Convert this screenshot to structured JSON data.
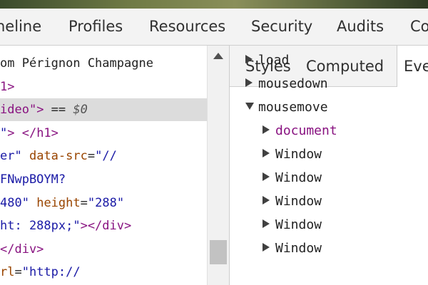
{
  "tabs": [
    "neline",
    "Profiles",
    "Resources",
    "Security",
    "Audits",
    "Co"
  ],
  "elements_lines": [
    {
      "parts": [
        [
          "txt",
          "om Pérignon Champagne"
        ]
      ]
    },
    {
      "parts": [
        [
          "tag",
          "1>"
        ]
      ]
    },
    {
      "parts": [
        [
          "tag",
          "ideo"
        ],
        [
          "tag",
          "\">"
        ],
        [
          "txt",
          " == "
        ],
        [
          "dollar",
          "$0"
        ]
      ]
    },
    {
      "parts": [
        [
          "val",
          "\""
        ],
        [
          "tag",
          "> </h1>"
        ]
      ]
    },
    {
      "parts": [
        [
          "val",
          "er\""
        ],
        [
          "txt",
          " "
        ],
        [
          "attr",
          "data-src"
        ],
        [
          "txt",
          "="
        ],
        [
          "val",
          "\"//"
        ]
      ]
    },
    {
      "parts": [
        [
          "val",
          "FNwpBOYM?"
        ]
      ]
    },
    {
      "parts": [
        [
          "val",
          "480\""
        ],
        [
          "txt",
          " "
        ],
        [
          "attr",
          "height"
        ],
        [
          "txt",
          "="
        ],
        [
          "val",
          "\"288\""
        ]
      ]
    },
    {
      "parts": [
        [
          "val",
          "ht: 288px;\""
        ],
        [
          "tag",
          "></div>"
        ]
      ]
    },
    {
      "parts": [
        [
          "tag",
          "</div>"
        ]
      ]
    },
    {
      "parts": [
        [
          "attr",
          "rl"
        ],
        [
          "txt",
          "="
        ],
        [
          "val",
          "\"http://"
        ]
      ]
    }
  ],
  "sidebar_tabs": [
    "Styles",
    "Computed",
    "Eve"
  ],
  "events": [
    {
      "label": "load",
      "expanded": false
    },
    {
      "label": "mousedown",
      "expanded": false
    },
    {
      "label": "mousemove",
      "expanded": true
    },
    {
      "label": "document",
      "child": true
    },
    {
      "label": "Window",
      "child": true
    },
    {
      "label": "Window",
      "child": true
    },
    {
      "label": "Window",
      "child": true
    },
    {
      "label": "Window",
      "child": true
    },
    {
      "label": "Window",
      "child": true
    }
  ]
}
